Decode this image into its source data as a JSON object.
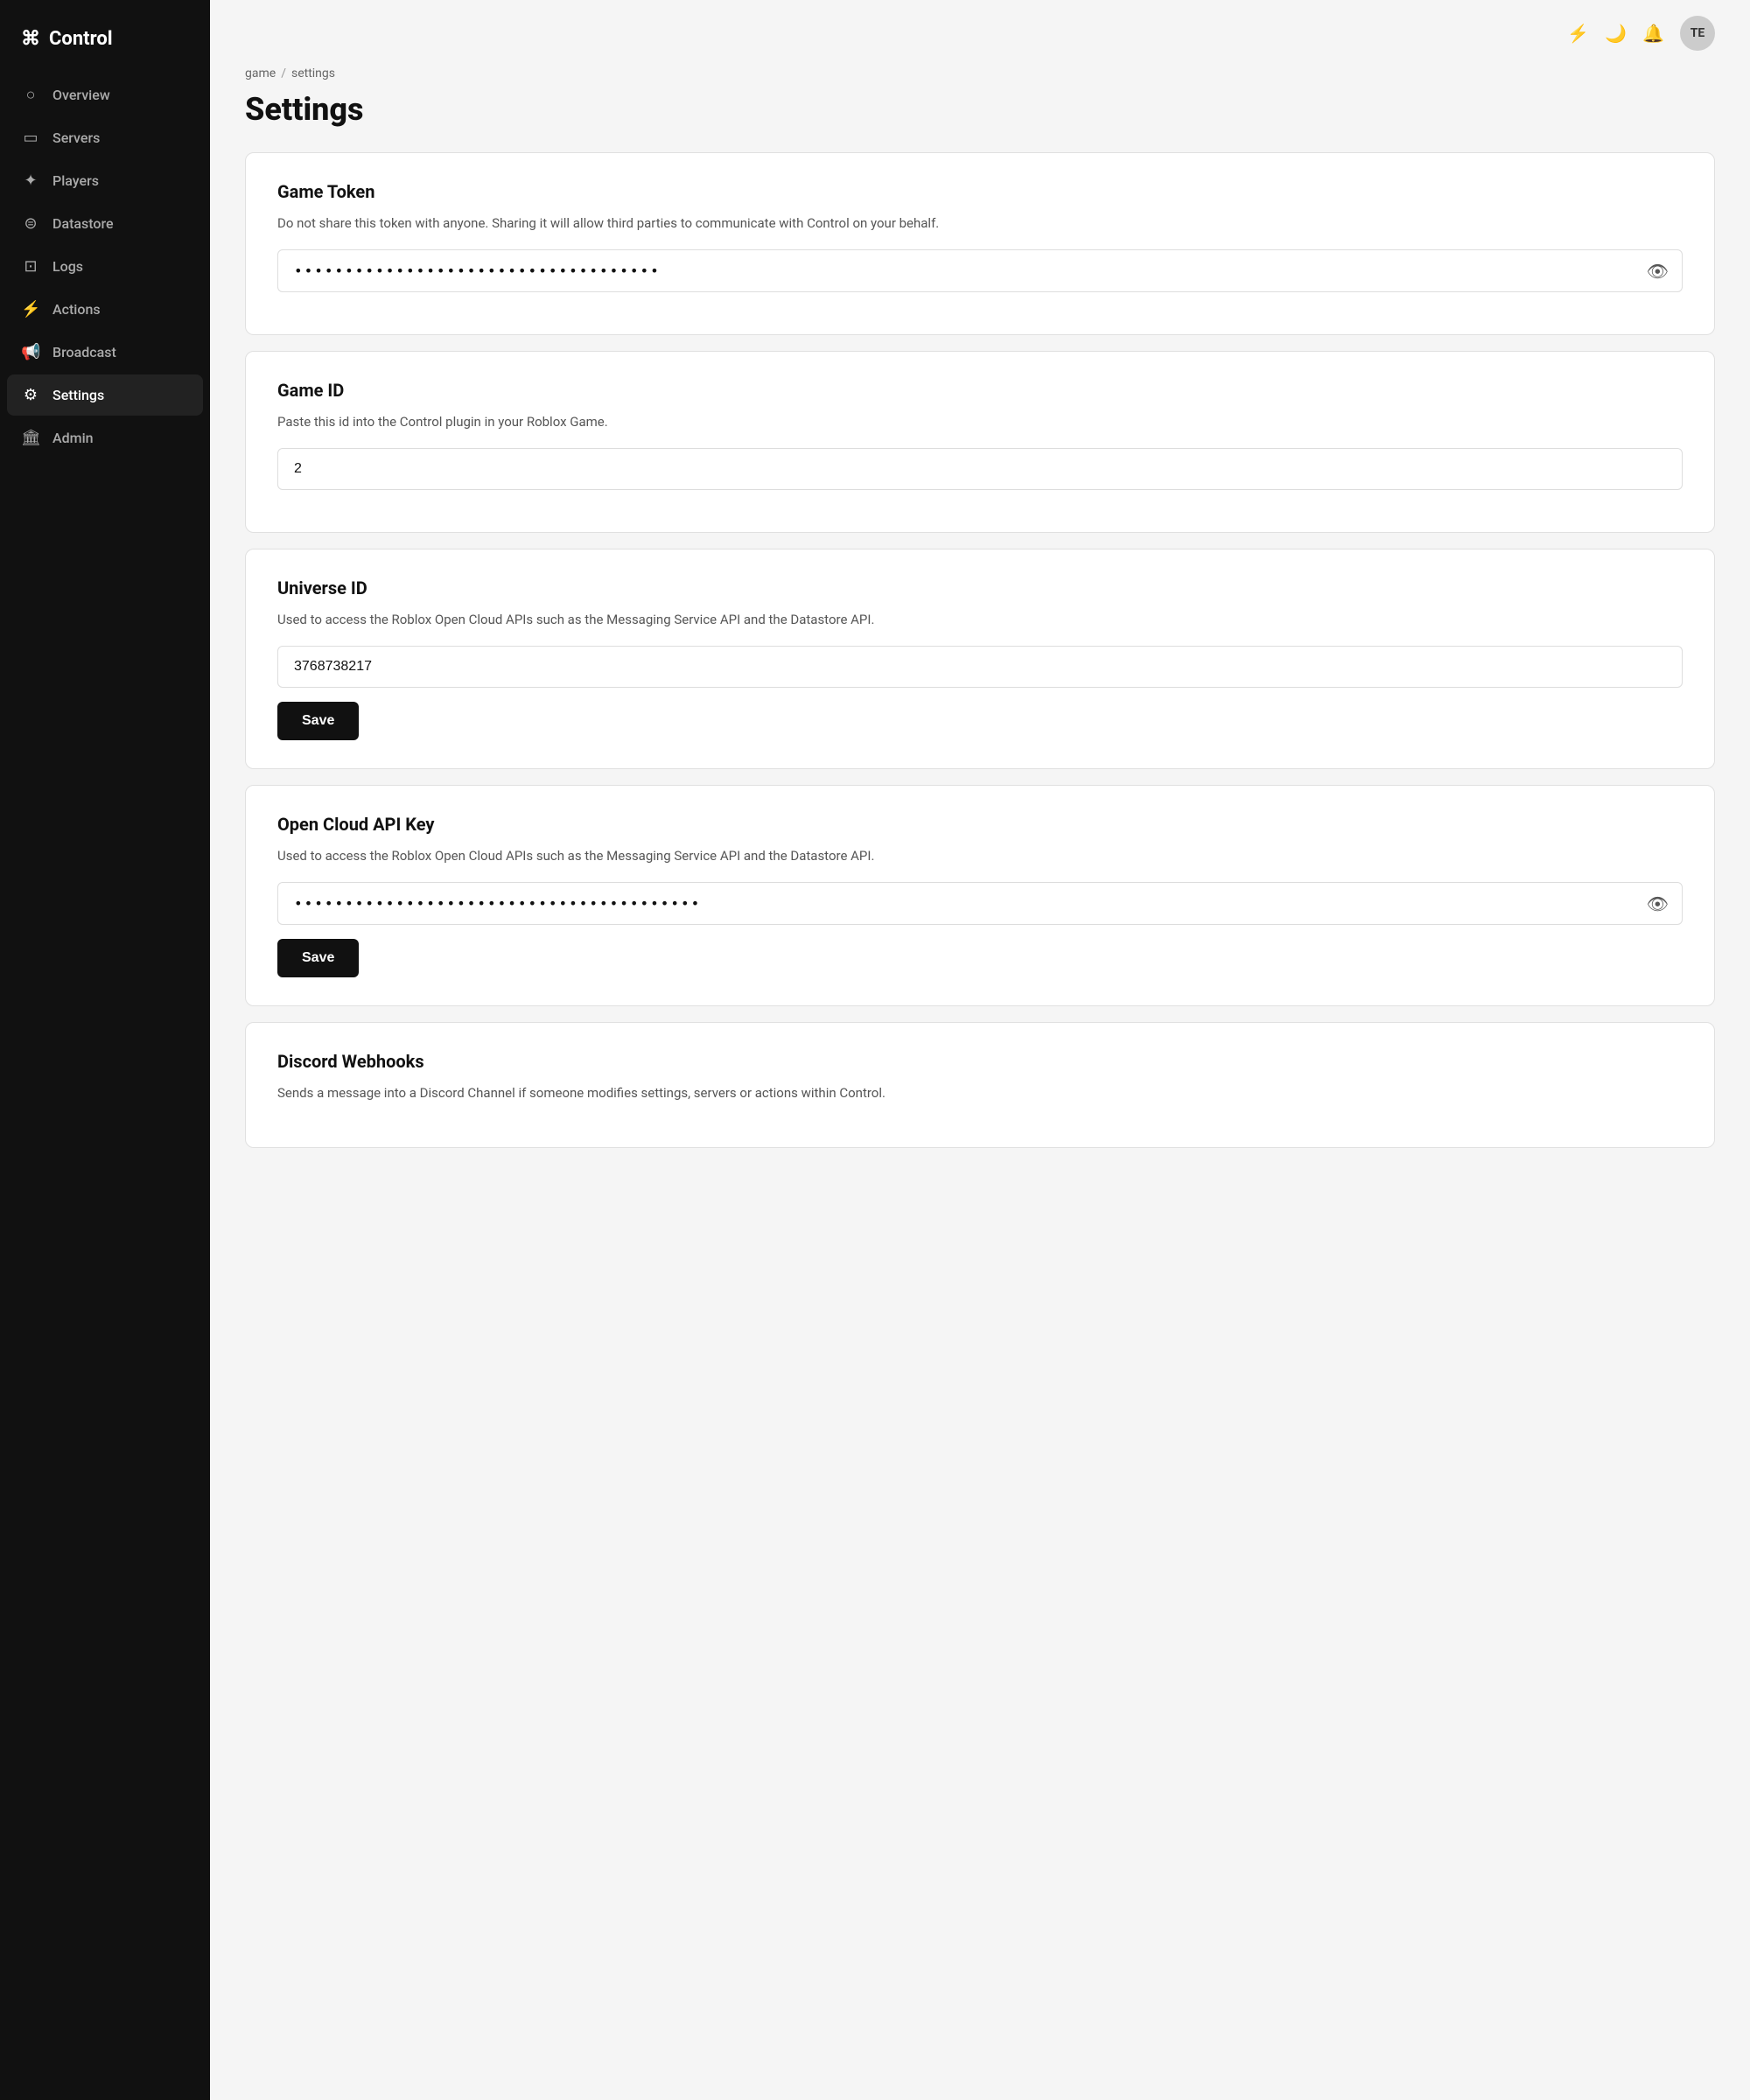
{
  "sidebar": {
    "logo": "Control",
    "logo_icon": "⌘",
    "items": [
      {
        "id": "overview",
        "label": "Overview",
        "icon": "○"
      },
      {
        "id": "servers",
        "label": "Servers",
        "icon": "▭"
      },
      {
        "id": "players",
        "label": "Players",
        "icon": "✦"
      },
      {
        "id": "datastore",
        "label": "Datastore",
        "icon": "⊜"
      },
      {
        "id": "logs",
        "label": "Logs",
        "icon": "⊡"
      },
      {
        "id": "actions",
        "label": "Actions",
        "icon": "⚡"
      },
      {
        "id": "broadcast",
        "label": "Broadcast",
        "icon": "📢"
      },
      {
        "id": "settings",
        "label": "Settings",
        "icon": "⚙"
      },
      {
        "id": "admin",
        "label": "Admin",
        "icon": "🏛"
      }
    ]
  },
  "topbar": {
    "flash_icon": "⚡",
    "moon_icon": "🌙",
    "bell_icon": "🔔",
    "avatar_label": "TE"
  },
  "breadcrumb": {
    "parts": [
      "game",
      "settings"
    ],
    "separator": "/"
  },
  "page": {
    "title": "Settings"
  },
  "cards": [
    {
      "id": "game-token",
      "title": "Game Token",
      "description": "Do not share this token with anyone. Sharing it will allow third parties to communicate with Control on your behalf.",
      "input_type": "password",
      "input_value": "••••••••••••••••••••••••••••••••••••",
      "has_eye": true,
      "has_save": false
    },
    {
      "id": "game-id",
      "title": "Game ID",
      "description": "Paste this id into the Control plugin in your Roblox Game.",
      "input_type": "text",
      "input_value": "2",
      "has_eye": false,
      "has_save": false
    },
    {
      "id": "universe-id",
      "title": "Universe ID",
      "description": "Used to access the Roblox Open Cloud APIs such as the Messaging Service API and the Datastore API.",
      "input_type": "text",
      "input_value": "3768738217",
      "has_eye": false,
      "has_save": true,
      "save_label": "Save"
    },
    {
      "id": "open-cloud-api-key",
      "title": "Open Cloud API Key",
      "description": "Used to access the Roblox Open Cloud APIs such as the Messaging Service API and the Datastore API.",
      "input_type": "password",
      "input_value": "••••••••••••••••••••••••••••••••••••••••",
      "has_eye": true,
      "has_save": true,
      "save_label": "Save"
    },
    {
      "id": "discord-webhooks",
      "title": "Discord Webhooks",
      "description": "Sends a message into a Discord Channel if someone modifies settings, servers or actions within Control.",
      "input_type": null,
      "has_eye": false,
      "has_save": false
    }
  ]
}
